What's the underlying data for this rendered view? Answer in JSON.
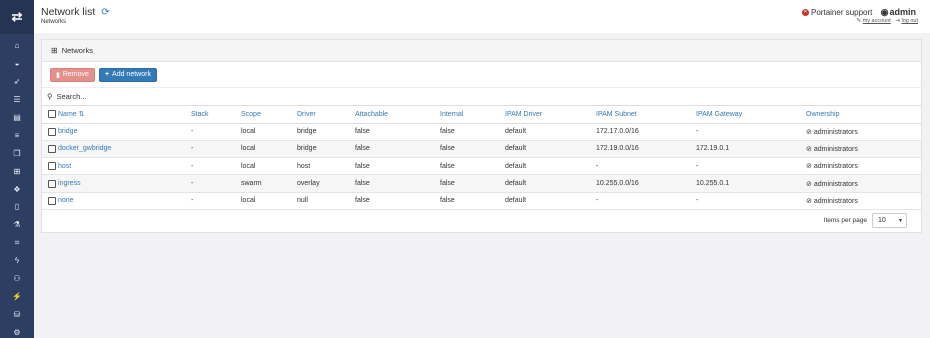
{
  "sidebar": {
    "toggle_icon": "exchange-icon",
    "items": [
      {
        "icon": "home-icon",
        "glyph": "⌂"
      },
      {
        "icon": "dashboard-icon",
        "glyph": "◒"
      },
      {
        "icon": "rocket-icon",
        "glyph": "➶"
      },
      {
        "icon": "list-icon",
        "glyph": "☰"
      },
      {
        "icon": "server-icon",
        "glyph": "▤"
      },
      {
        "icon": "list-alt-icon",
        "glyph": "≡"
      },
      {
        "icon": "clone-icon",
        "glyph": "❐"
      },
      {
        "icon": "sitemap-icon",
        "glyph": "⊞",
        "active": true
      },
      {
        "icon": "cubes-icon",
        "glyph": "❖"
      },
      {
        "icon": "file-icon",
        "glyph": "▯"
      },
      {
        "icon": "flask-icon",
        "glyph": "⚗"
      },
      {
        "icon": "object-group-icon",
        "glyph": "⌗"
      },
      {
        "icon": "bolt-icon",
        "glyph": "ϟ"
      },
      {
        "icon": "users-icon",
        "glyph": "⚇"
      },
      {
        "icon": "plug-icon",
        "glyph": "⚡"
      },
      {
        "icon": "database-icon",
        "glyph": "⛁"
      },
      {
        "icon": "cogs-icon",
        "glyph": "⚙"
      }
    ]
  },
  "header": {
    "title": "Network list",
    "breadcrumb": "Networks",
    "support_label": "Portainer support",
    "user": "admin",
    "my_account": "my account",
    "log_out": "log out"
  },
  "panel": {
    "title": "Networks",
    "remove_label": "Remove",
    "add_label": "Add network",
    "search_placeholder": "Search..."
  },
  "table": {
    "columns": [
      "Name",
      "Stack",
      "Scope",
      "Driver",
      "Attachable",
      "Internal",
      "IPAM Driver",
      "IPAM Subnet",
      "IPAM Gateway",
      "Ownership"
    ],
    "rows": [
      {
        "name": "bridge",
        "stack": "-",
        "scope": "local",
        "driver": "bridge",
        "attachable": "false",
        "internal": "false",
        "ipam_driver": "default",
        "subnet": "172.17.0.0/16",
        "gateway": "-",
        "ownership": "administrators"
      },
      {
        "name": "docker_gwbridge",
        "stack": "-",
        "scope": "local",
        "driver": "bridge",
        "attachable": "false",
        "internal": "false",
        "ipam_driver": "default",
        "subnet": "172.19.0.0/16",
        "gateway": "172.19.0.1",
        "ownership": "administrators"
      },
      {
        "name": "host",
        "stack": "-",
        "scope": "local",
        "driver": "host",
        "attachable": "false",
        "internal": "false",
        "ipam_driver": "default",
        "subnet": "-",
        "gateway": "-",
        "ownership": "administrators"
      },
      {
        "name": "ingress",
        "stack": "-",
        "scope": "swarm",
        "driver": "overlay",
        "attachable": "false",
        "internal": "false",
        "ipam_driver": "default",
        "subnet": "10.255.0.0/16",
        "gateway": "10.255.0.1",
        "ownership": "administrators"
      },
      {
        "name": "none",
        "stack": "-",
        "scope": "local",
        "driver": "null",
        "attachable": "false",
        "internal": "false",
        "ipam_driver": "default",
        "subnet": "-",
        "gateway": "-",
        "ownership": "administrators"
      }
    ]
  },
  "pagination": {
    "label": "Items per page",
    "value": "10"
  }
}
